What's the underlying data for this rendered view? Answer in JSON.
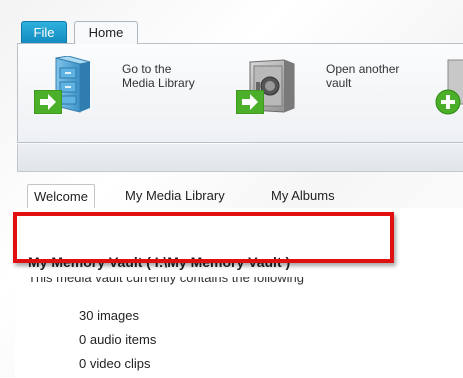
{
  "ribbon_tabs": {
    "file": "File",
    "home": "Home"
  },
  "ribbon": {
    "go_library": {
      "line1": "Go to the",
      "line2": "Media Library",
      "icon": "file-cabinet-icon"
    },
    "open_vault": {
      "line1": "Open another",
      "line2": "vault",
      "icon": "safe-icon"
    },
    "add": {
      "icon": "add-icon"
    }
  },
  "view_tabs": [
    "Welcome",
    "My Media Library",
    "My Albums"
  ],
  "vault": {
    "title": "My Memory Vault ( I:\\My Memory Vault )",
    "description": "This media vault currently contains the following",
    "stats": [
      "30 images",
      "0 audio items",
      "0 video clips"
    ]
  },
  "colors": {
    "file_tab": "#1a9bd0",
    "highlight": "#e01010",
    "arrow_green": "#4caf2a"
  }
}
